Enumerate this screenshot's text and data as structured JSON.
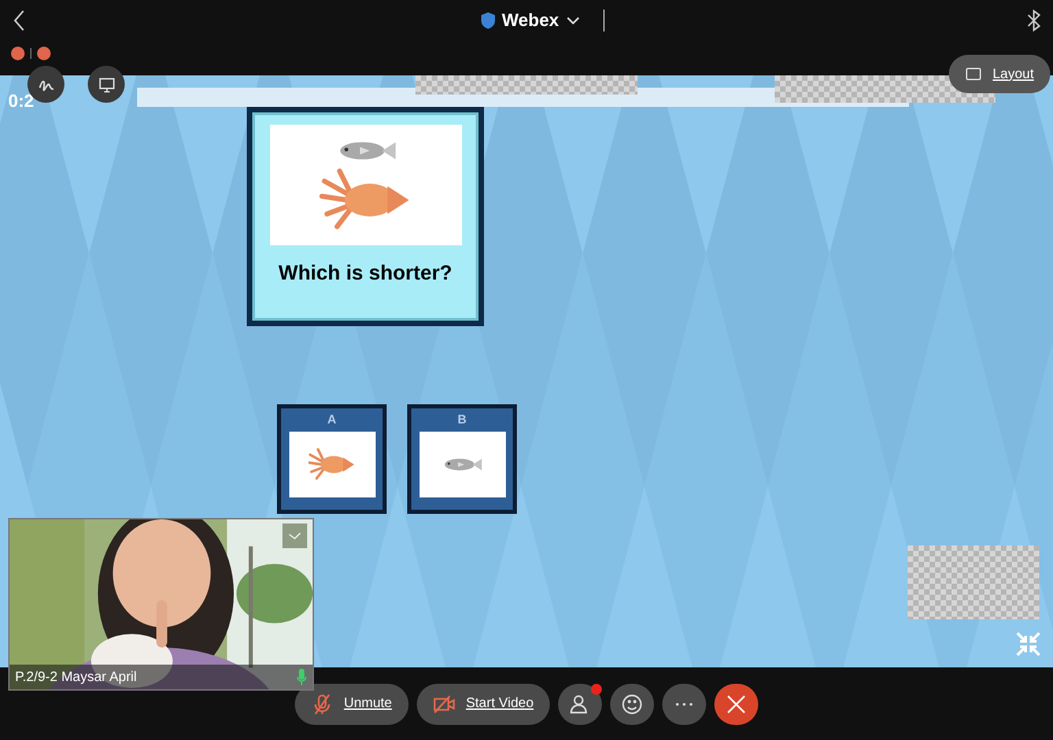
{
  "header": {
    "title": "Webex"
  },
  "timer": "0:2",
  "layout_button": {
    "label": "Layout"
  },
  "slide": {
    "question": "Which is shorter?",
    "options": [
      {
        "label": "A",
        "kind": "squid"
      },
      {
        "label": "B",
        "kind": "fish"
      }
    ]
  },
  "video_tile": {
    "name": "P.2/9-2 Maysar April",
    "mic_on": true
  },
  "controls": [
    {
      "kind": "unmute",
      "label": "Unmute"
    },
    {
      "kind": "video",
      "label": "Start Video"
    },
    {
      "kind": "participants",
      "badge": true
    },
    {
      "kind": "reactions"
    },
    {
      "kind": "more"
    },
    {
      "kind": "leave"
    }
  ]
}
